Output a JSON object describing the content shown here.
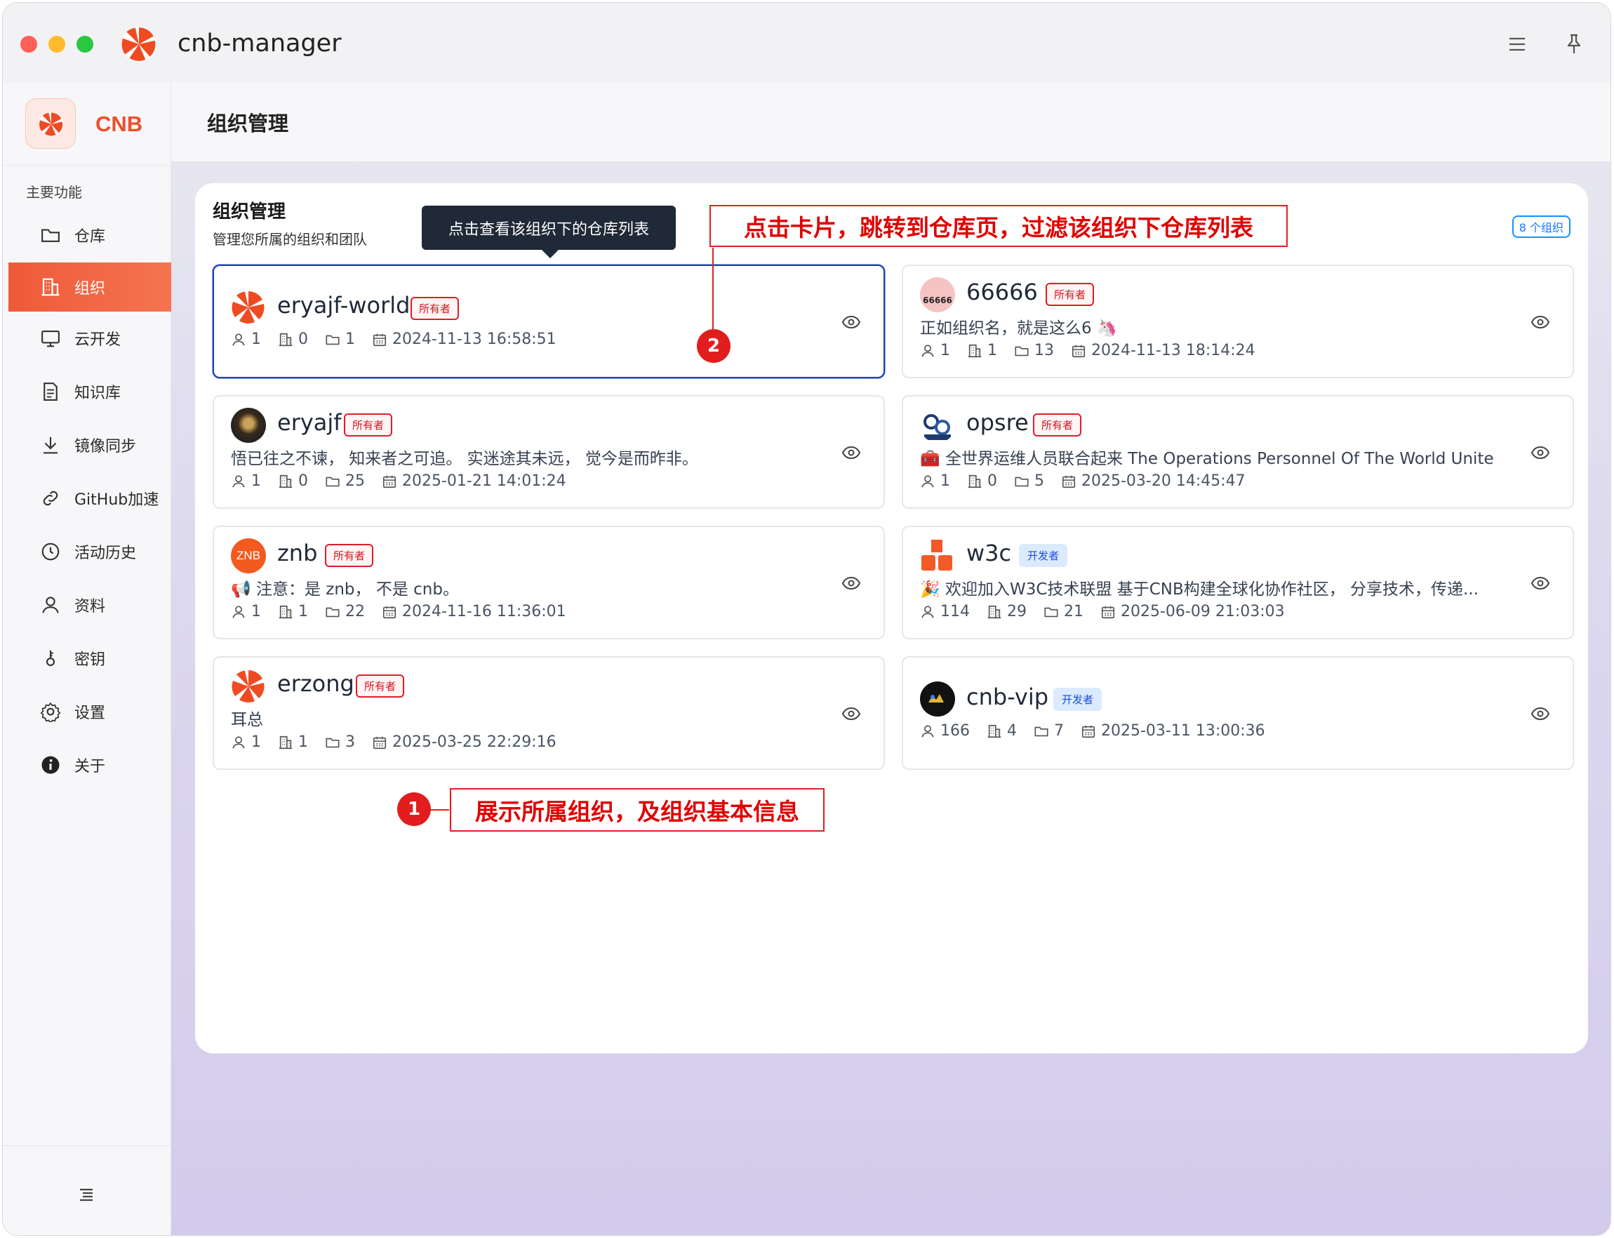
{
  "window": {
    "title": "cnb-manager"
  },
  "sidebar": {
    "brand": "CNB",
    "section": "主要功能",
    "items": [
      {
        "label": "仓库",
        "icon": "folder-icon"
      },
      {
        "label": "组织",
        "icon": "building-icon",
        "active": true
      },
      {
        "label": "云开发",
        "icon": "monitor-icon"
      },
      {
        "label": "知识库",
        "icon": "document-icon"
      },
      {
        "label": "镜像同步",
        "icon": "download-icon"
      },
      {
        "label": "GitHub加速",
        "icon": "link-icon"
      },
      {
        "label": "活动历史",
        "icon": "clock-icon"
      },
      {
        "label": "资料",
        "icon": "user-icon"
      },
      {
        "label": "密钥",
        "icon": "key-icon"
      },
      {
        "label": "设置",
        "icon": "gear-icon"
      },
      {
        "label": "关于",
        "icon": "info-icon"
      }
    ]
  },
  "page": {
    "title": "组织管理"
  },
  "panel": {
    "title": "组织管理",
    "subtitle": "管理您所属的组织和团队",
    "count_badge": "8 个组织"
  },
  "tooltip": "点击查看该组织下的仓库列表",
  "orgs": [
    {
      "name": "eryajf-world",
      "role": "所有者",
      "desc": "",
      "members": "1",
      "repos_groups": "0",
      "repos": "1",
      "created": "2024-11-13 16:58:51"
    },
    {
      "name": "66666",
      "role": "所有者",
      "desc": "正如组织名，就是这么6 🦄",
      "members": "1",
      "repos_groups": "1",
      "repos": "13",
      "created": "2024-11-13 18:14:24"
    },
    {
      "name": "eryajf",
      "role": "所有者",
      "desc": "悟已往之不谏， 知来者之可追。 实迷途其未远， 觉今是而昨非。",
      "members": "1",
      "repos_groups": "0",
      "repos": "25",
      "created": "2025-01-21 14:01:24"
    },
    {
      "name": "opsre",
      "role": "所有者",
      "desc": "🧰 全世界运维人员联合起来 The Operations Personnel Of The World Unite",
      "members": "1",
      "repos_groups": "0",
      "repos": "5",
      "created": "2025-03-20 14:45:47"
    },
    {
      "name": "znb",
      "role": "所有者",
      "desc": "📢 注意：是 znb， 不是 cnb。",
      "members": "1",
      "repos_groups": "1",
      "repos": "22",
      "created": "2024-11-16 11:36:01"
    },
    {
      "name": "w3c",
      "role": "开发者",
      "desc": "🎉 欢迎加入W3C技术联盟 基于CNB构建全球化协作社区， 分享技术，传递...",
      "members": "114",
      "repos_groups": "29",
      "repos": "21",
      "created": "2025-06-09 21:03:03"
    },
    {
      "name": "erzong",
      "role": "所有者",
      "desc": "耳总",
      "members": "1",
      "repos_groups": "1",
      "repos": "3",
      "created": "2025-03-25 22:29:16"
    },
    {
      "name": "cnb-vip",
      "role": "开发者",
      "desc": "",
      "members": "166",
      "repos_groups": "4",
      "repos": "7",
      "created": "2025-03-11 13:00:36"
    }
  ],
  "annotations": {
    "a1": {
      "num": "1",
      "text": "展示所属组织，及组织基本信息"
    },
    "a2": {
      "num": "2",
      "text": "点击卡片，跳转到仓库页，过滤该组织下仓库列表"
    }
  },
  "avatar_texts": {
    "znb": "ZNB",
    "sixes": "66666"
  },
  "colors": {
    "brand": "#ec4f2b",
    "active_nav": "#ef5a39",
    "owner_tag": "#e11d27",
    "dev_tag": "#1d4ed8",
    "annotation": "#e11d1d"
  }
}
